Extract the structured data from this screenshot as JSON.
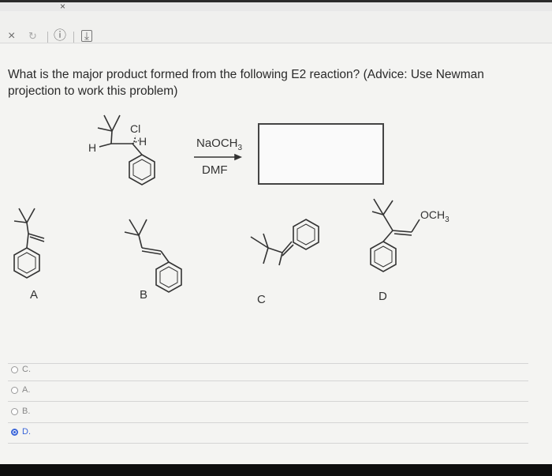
{
  "browser": {
    "tab_close_glyph": "×",
    "close_glyph": "×",
    "reload_glyph": "↻",
    "info_glyph": "ⓘ",
    "download_glyph": "⤓"
  },
  "question": {
    "text": "What is the major product formed from the following E2 reaction? (Advice: Use Newman projection to work this problem)"
  },
  "reaction": {
    "reagent_top": "NaOCH3",
    "reagent_bottom": "DMF",
    "substituent_cl": "Cl",
    "substituent_h1": "H",
    "substituent_h2": "H"
  },
  "structures": [
    {
      "label": "A"
    },
    {
      "label": "B"
    },
    {
      "label": "C"
    },
    {
      "label": "D",
      "substituent": "OCH3"
    }
  ],
  "options": [
    {
      "label": "C.",
      "selected": false
    },
    {
      "label": "A.",
      "selected": false
    },
    {
      "label": "B.",
      "selected": false
    },
    {
      "label": "D.",
      "selected": true
    }
  ],
  "colors": {
    "selected_radio": "#3b66d9",
    "page_bg": "#f4f4f2"
  }
}
